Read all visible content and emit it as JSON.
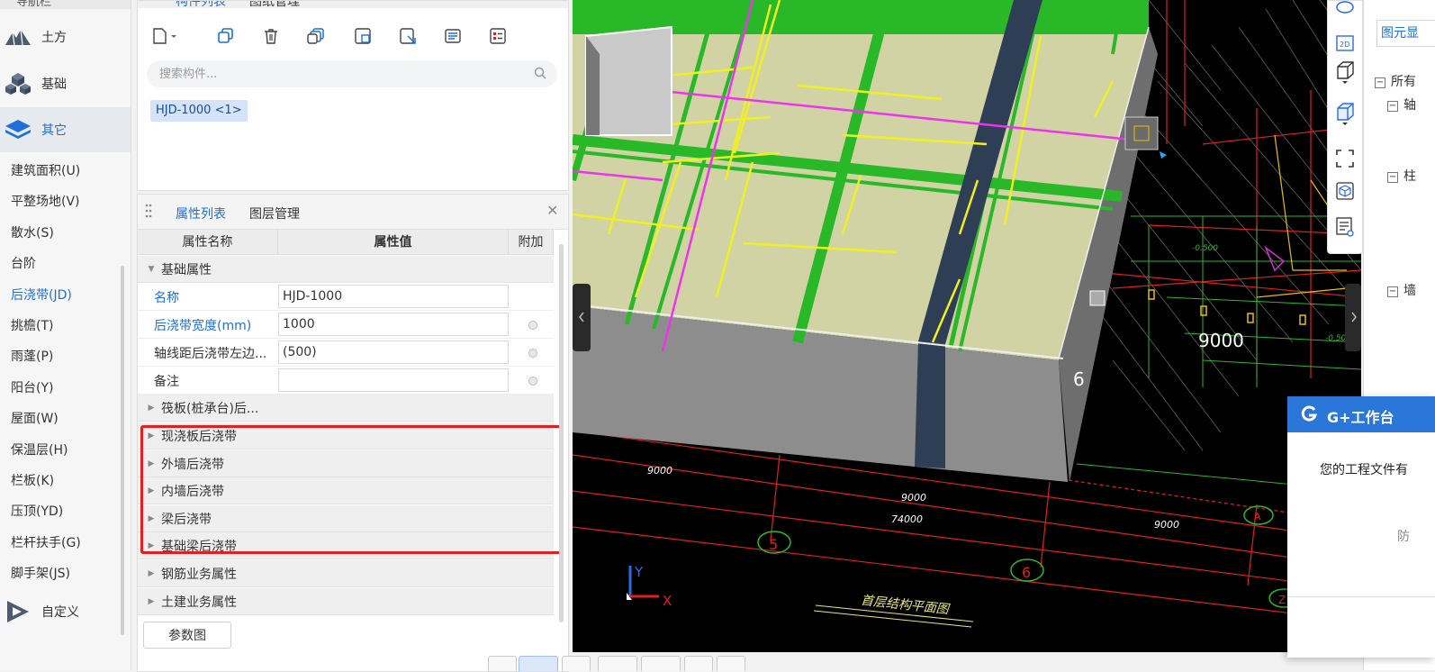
{
  "nav": {
    "title": "导航栏",
    "categories": [
      {
        "label": "土方",
        "icon": "earthwork-icon"
      },
      {
        "label": "基础",
        "icon": "foundation-icon"
      },
      {
        "label": "其它",
        "icon": "layers-icon"
      },
      {
        "label": "自定义",
        "icon": "custom-icon"
      }
    ],
    "items": [
      "建筑面积(U)",
      "平整场地(V)",
      "散水(S)",
      "台阶",
      "后浇带(JD)",
      "挑檐(T)",
      "雨蓬(P)",
      "阳台(Y)",
      "屋面(W)",
      "保温层(H)",
      "栏板(K)",
      "压顶(YD)",
      "栏杆扶手(G)",
      "脚手架(JS)"
    ],
    "active_item": "后浇带(JD)"
  },
  "component_list": {
    "tabs": [
      "构件列表",
      "图纸管理"
    ],
    "search_placeholder": "搜索构件...",
    "chip": "HJD-1000 <1>"
  },
  "properties": {
    "tabs": [
      "属性列表",
      "图层管理"
    ],
    "columns": [
      "属性名称",
      "属性值",
      "附加"
    ],
    "group_basic": "基础属性",
    "rows": [
      {
        "name": "名称",
        "value": "HJD-1000"
      },
      {
        "name": "后浇带宽度(mm)",
        "value": "1000"
      },
      {
        "name": "轴线距后浇带左边...",
        "value": "(500)"
      },
      {
        "name": "备注",
        "value": ""
      }
    ],
    "groups": [
      "筏板(桩承台)后...",
      "现浇板后浇带",
      "外墙后浇带",
      "内墙后浇带",
      "梁后浇带",
      "基础梁后浇带",
      "钢筋业务属性",
      "土建业务属性"
    ],
    "param_button": "参数图"
  },
  "viewport": {
    "labels": {
      "dim_9000_a": "9000",
      "dim_9000_b": "9000",
      "dim_9000_c": "9000",
      "dim_9000_big": "9000",
      "dim_74000": "74000",
      "axis_5": "5",
      "axis_6": "6",
      "axis_6_edge": "6",
      "axis_a": "A",
      "axis_z": "Z",
      "elev_1": "-0.500",
      "elev_2": "-0.500",
      "drawing_title": "首层结构平面图",
      "coord_y": "Y",
      "coord_x": "X"
    }
  },
  "right_panel": {
    "tab": "图元显",
    "tree": [
      "所有",
      "轴",
      "柱",
      "墙"
    ]
  },
  "popup": {
    "title": "G+工作台",
    "message": "您的工程文件有",
    "sub": "防"
  },
  "colors": {
    "accent": "#1e6fd9",
    "highlight_box": "#e02020",
    "slab": "#d2d3a4",
    "beam_green": "#2fb52f",
    "popup_header": "#2a76d9"
  }
}
